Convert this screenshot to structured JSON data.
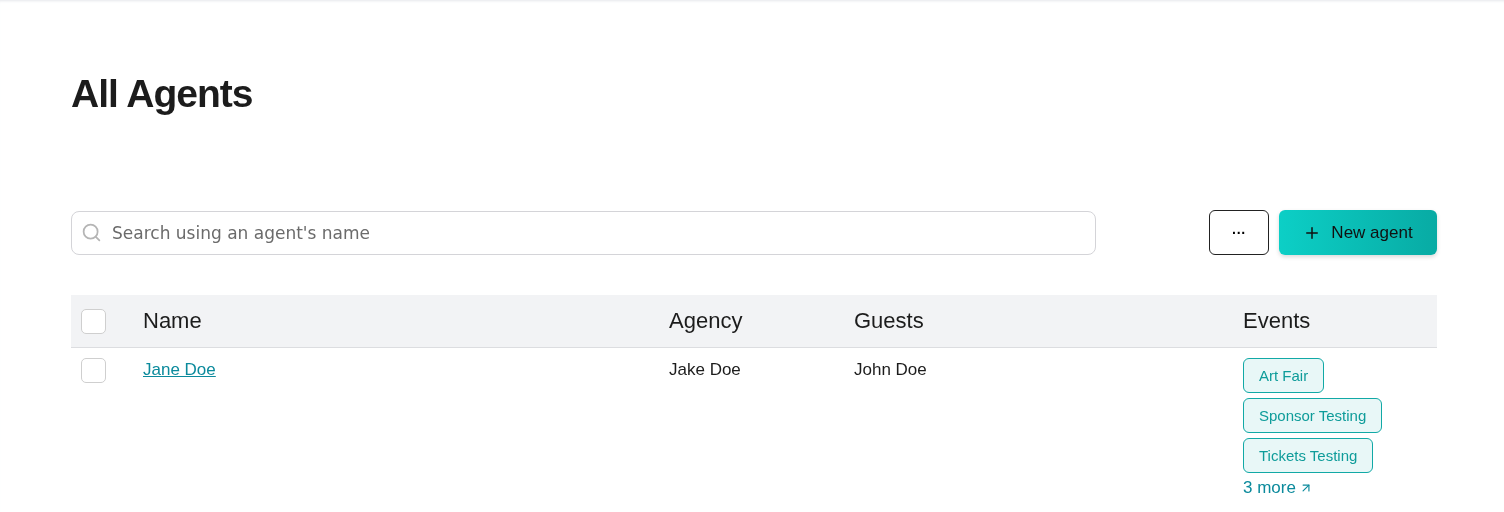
{
  "title": "All Agents",
  "search": {
    "placeholder": "Search using an agent's name"
  },
  "actions": {
    "more": "···",
    "new_agent": "New agent"
  },
  "table": {
    "select_all": {
      "checked": false
    },
    "columns": [
      "Name",
      "Agency",
      "Guests",
      "Events"
    ],
    "rows": [
      {
        "checked": false,
        "name": "Jane Doe",
        "agency": "Jake Doe",
        "guests": "John Doe",
        "events": [
          "Art Fair",
          "Sponsor Testing",
          "Tickets Testing"
        ],
        "more": "3 more"
      }
    ]
  }
}
